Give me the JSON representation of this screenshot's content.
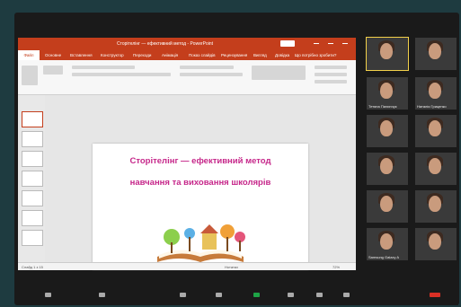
{
  "window": {
    "title": "Сторітелінг — ефективний метод - PowerPoint",
    "sign_in": "Вхід"
  },
  "menu": [
    "Файл",
    "Основне",
    "Вставлення",
    "Конструктор",
    "Переходи",
    "Анімація",
    "Показ слайдів",
    "Рецензування",
    "Вигляд",
    "Довідка",
    "Що потрібно зробити?"
  ],
  "slide": {
    "title": "Сторітелінг — ефективний метод",
    "subtitle": "навчання та виховання школярів"
  },
  "status": {
    "slide_indicator": "Слайд 1 з 15",
    "notes": "Нотатки",
    "zoom": "72%"
  },
  "participants": [
    {
      "name": ""
    },
    {
      "name": ""
    },
    {
      "name": "Тетяна Пилипчук"
    },
    {
      "name": "Наталія Гриценко"
    },
    {
      "name": ""
    },
    {
      "name": ""
    },
    {
      "name": ""
    },
    {
      "name": ""
    },
    {
      "name": ""
    },
    {
      "name": ""
    },
    {
      "name": "Samsung Galaxy A"
    },
    {
      "name": ""
    }
  ],
  "toolbar": {
    "icons": [
      "mute-icon",
      "video-icon",
      "security-icon",
      "participants-icon",
      "chat-icon",
      "share-screen-icon",
      "record-icon",
      "reactions-icon",
      "end-call-icon"
    ]
  },
  "colors": {
    "ppt_accent": "#c43e1c",
    "slide_title": "#c6278a",
    "share_green": "#1ea446",
    "end_red": "#d93025"
  }
}
